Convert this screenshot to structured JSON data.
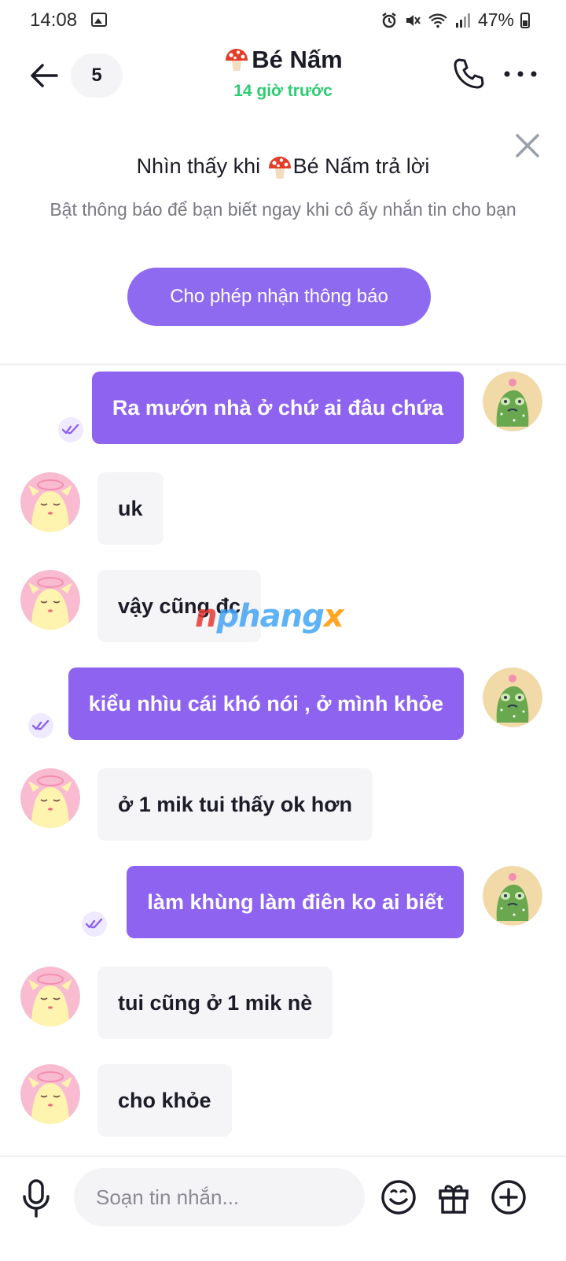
{
  "status_bar": {
    "time": "14:08",
    "battery": "47%"
  },
  "header": {
    "unread_count": "5",
    "name": "Bé Nấm",
    "last_seen": "14 giờ trước"
  },
  "notification": {
    "title_prefix": "Nhìn thấy khi ",
    "title_name": "Bé Nấm",
    "title_suffix": " trả lời",
    "body": "Bật thông báo để bạn biết ngay khi cô ấy nhắn tin cho bạn",
    "button": "Cho phép nhận thông báo"
  },
  "messages": [
    {
      "direction": "out",
      "text": "Ra mướn nhà ở chứ ai đâu chứa"
    },
    {
      "direction": "in",
      "text": "uk"
    },
    {
      "direction": "in",
      "text": "vậy cũng đc"
    },
    {
      "direction": "out",
      "text": "kiểu nhìu cái khó nói , ở mình khỏe"
    },
    {
      "direction": "in",
      "text": "ở 1 mik tui thấy ok hơn"
    },
    {
      "direction": "out",
      "text": "làm khùng làm điên ko ai biết"
    },
    {
      "direction": "in",
      "text": "tui cũng ở 1 mik nè"
    },
    {
      "direction": "in",
      "text": "cho khỏe"
    }
  ],
  "watermark": {
    "part1": "n",
    "part2": "phang",
    "part3": "x"
  },
  "composer": {
    "placeholder": "Soạn tin nhắn..."
  },
  "colors": {
    "accent": "#8e63f0",
    "online": "#2ecc71",
    "incoming_bubble": "#f5f5f8"
  }
}
